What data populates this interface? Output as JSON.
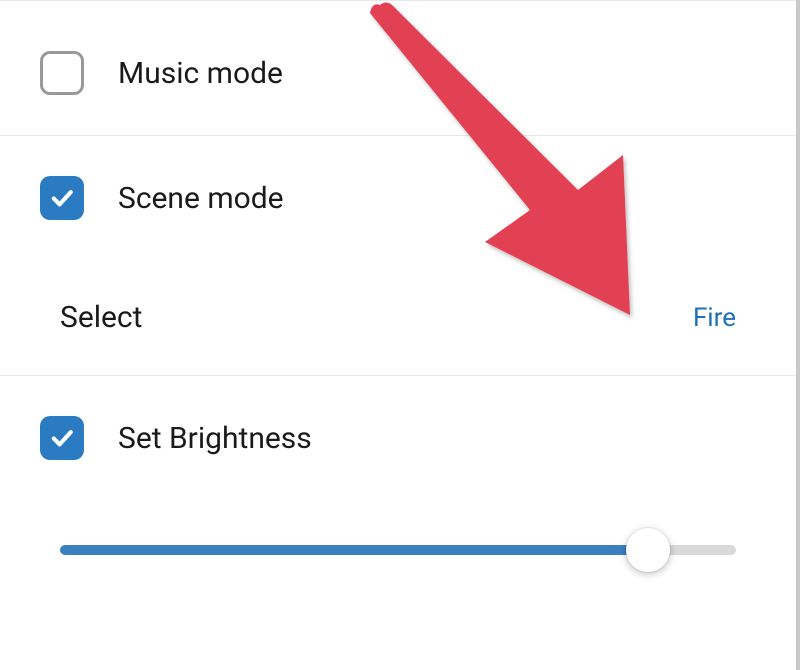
{
  "options": {
    "music": {
      "label": "Music mode",
      "checked": false
    },
    "scene": {
      "label": "Scene mode",
      "checked": true,
      "select_label": "Select",
      "select_value": "Fire"
    },
    "brightness": {
      "label": "Set Brightness",
      "checked": true,
      "value_percent": 87
    }
  },
  "colors": {
    "accent": "#2b7bc2",
    "link": "#1e6fb8",
    "arrow": "#e24152"
  }
}
